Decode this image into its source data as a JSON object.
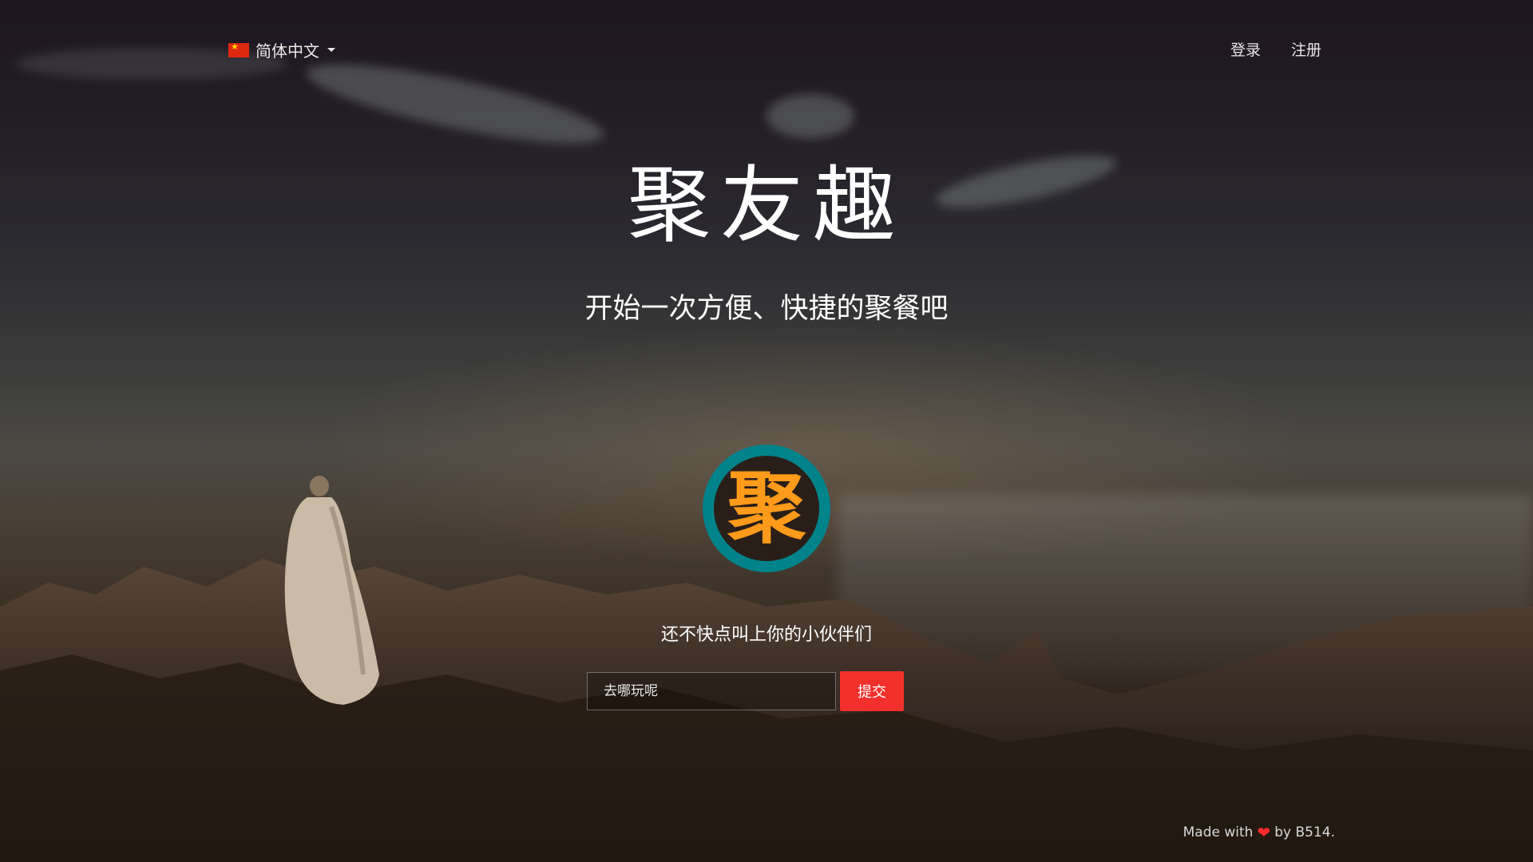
{
  "header": {
    "language": {
      "label": "简体中文",
      "flag_icon": "cn-flag-icon",
      "selected": "简体中文"
    },
    "nav": {
      "login": "登录",
      "register": "注册"
    }
  },
  "hero": {
    "title": "聚友趣",
    "subtitle": "开始一次方便、快捷的聚餐吧",
    "logo_char": "聚",
    "cta_text": "还不快点叫上你的小伙伴们"
  },
  "form": {
    "placeholder": "去哪玩呢",
    "submit_label": "提交"
  },
  "footer": {
    "made_with": "Made with",
    "heart": "❤",
    "by": "by B514."
  },
  "colors": {
    "logo_ring": "#00838a",
    "logo_char": "#ff9a1a",
    "submit_button": "#f4302d",
    "heart": "#ff2b2b"
  }
}
